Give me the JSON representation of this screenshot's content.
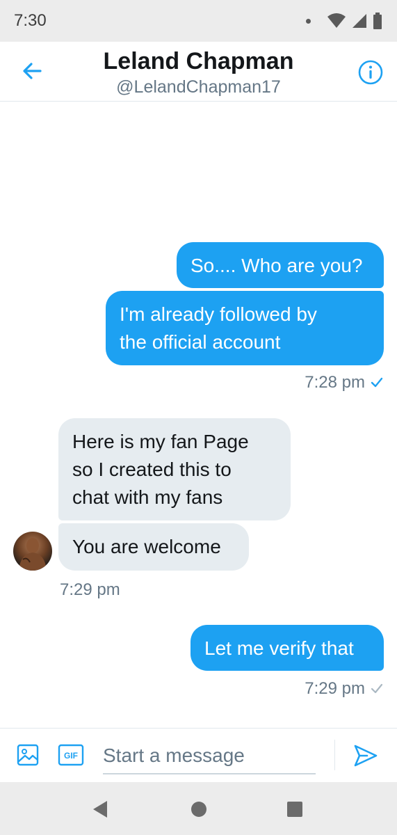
{
  "status_bar": {
    "time": "7:30"
  },
  "header": {
    "title": "Leland Chapman",
    "handle": "@LelandChapman17"
  },
  "messages": [
    {
      "direction": "outgoing",
      "text": "So.... Who are you?"
    },
    {
      "direction": "outgoing",
      "text_lines": [
        "I'm already followed by",
        "the official account"
      ]
    },
    {
      "direction": "incoming",
      "text_lines": [
        "Here is my fan Page",
        "so I created this to",
        "chat with my fans"
      ]
    },
    {
      "direction": "incoming",
      "text": "You are welcome"
    },
    {
      "direction": "outgoing",
      "text": "Let me verify that"
    }
  ],
  "timestamps": [
    "7:28 pm",
    "7:29 pm",
    "7:29 pm"
  ],
  "composer": {
    "placeholder": "Start a message"
  },
  "colors": {
    "accent": "#1da1f2",
    "incoming_bubble": "#e6ecf0",
    "secondary_text": "#657786"
  },
  "icons": [
    "arrow-left-icon",
    "info-icon",
    "image-icon",
    "gif-icon",
    "send-icon",
    "wifi-icon",
    "signal-icon",
    "battery-icon",
    "back-triangle-icon",
    "home-circle-icon",
    "recents-square-icon",
    "checkmark-icon"
  ]
}
